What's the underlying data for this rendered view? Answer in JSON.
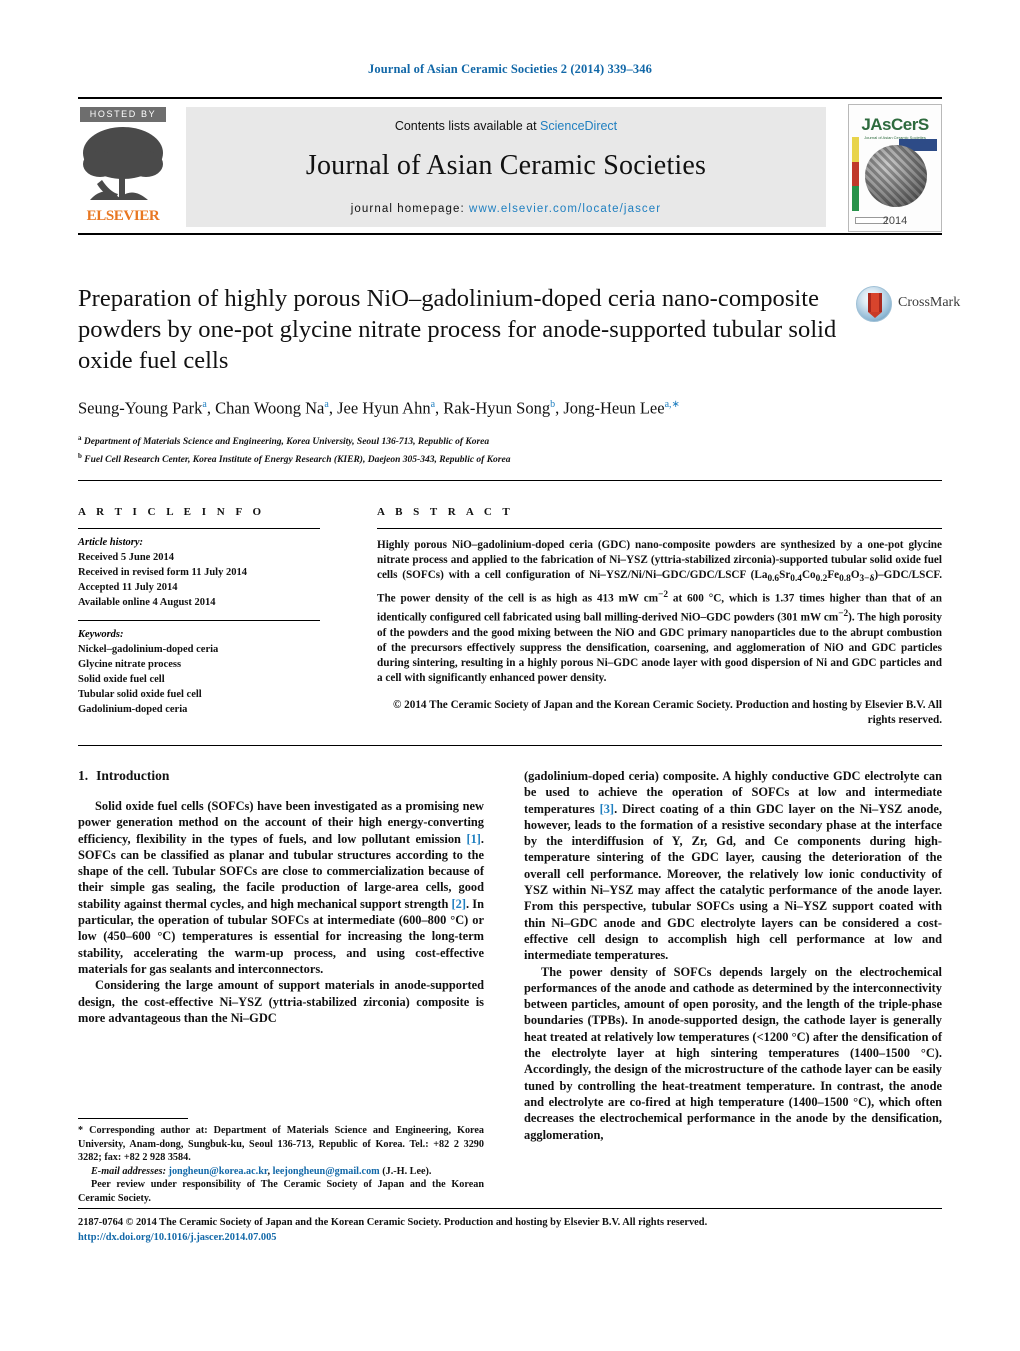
{
  "running_head": "Journal of Asian Ceramic Societies 2 (2014) 339–346",
  "masthead": {
    "hosted_by": "HOSTED BY",
    "publisher": "ELSEVIER",
    "contents_prefix": "Contents lists available at ",
    "contents_link": "ScienceDirect",
    "journal_title": "Journal of Asian Ceramic Societies",
    "homepage_prefix": "journal homepage: ",
    "homepage_url": "www.elsevier.com/locate/jascer",
    "cover": {
      "brand": "JAsCerS",
      "subtitle": "Journal of Asian Ceramic Societies",
      "year": "2014"
    }
  },
  "article": {
    "title": "Preparation of highly porous NiO–gadolinium-doped ceria nano-composite powders by one-pot glycine nitrate process for anode-supported tubular solid oxide fuel cells",
    "authors_html": "Seung-Young Park<sup>a</sup>, Chan Woong Na<sup>a</sup>, Jee Hyun Ahn<sup>a</sup>, Rak-Hyun Song<sup>b</sup>, Jong-Heun Lee<sup>a,∗</sup>",
    "affiliation_a": "Department of Materials Science and Engineering, Korea University, Seoul 136-713, Republic of Korea",
    "affiliation_b": "Fuel Cell Research Center, Korea Institute of Energy Research (KIER), Daejeon 305-343, Republic of Korea",
    "crossmark_label": "CrossMark"
  },
  "article_info": {
    "heading": "A R T I C L E    I N F O",
    "history_label": "Article history:",
    "history": [
      "Received 5 June 2014",
      "Received in revised form 11 July 2014",
      "Accepted 11 July 2014",
      "Available online 4 August 2014"
    ],
    "keywords_label": "Keywords:",
    "keywords": [
      "Nickel–gadolinium-doped ceria",
      "Glycine nitrate process",
      "Solid oxide fuel cell",
      "Tubular solid oxide fuel cell",
      "Gadolinium-doped ceria"
    ]
  },
  "abstract": {
    "heading": "A B S T R A C T",
    "text": "Highly porous NiO–gadolinium-doped ceria (GDC) nano-composite powders are synthesized by a one-pot glycine nitrate process and applied to the fabrication of Ni–YSZ (yttria-stabilized zirconia)-supported tubular solid oxide fuel cells (SOFCs) with a cell configuration of Ni–YSZ/Ni/Ni–GDC/GDC/LSCF (La0.6Sr0.4Co0.2Fe0.8O3−δ)–GDC/LSCF. The power density of the cell is as high as 413 mW cm−2 at 600 °C, which is 1.37 times higher than that of an identically configured cell fabricated using ball milling-derived NiO–GDC powders (301 mW cm−2). The high porosity of the powders and the good mixing between the NiO and GDC primary nanoparticles due to the abrupt combustion of the precursors effectively suppress the densification, coarsening, and agglomeration of NiO and GDC particles during sintering, resulting in a highly porous Ni–GDC anode layer with good dispersion of Ni and GDC particles and a cell with significantly enhanced power density.",
    "copyright": "© 2014 The Ceramic Society of Japan and the Korean Ceramic Society. Production and hosting by Elsevier B.V. All rights reserved."
  },
  "introduction": {
    "number": "1.",
    "heading": "Introduction",
    "paragraph_1": "Solid oxide fuel cells (SOFCs) have been investigated as a promising new power generation method on the account of their high energy-converting efficiency, flexibility in the types of fuels, and low pollutant emission [1]. SOFCs can be classified as planar and tubular structures according to the shape of the cell. Tubular SOFCs are close to commercialization because of their simple gas sealing, the facile production of large-area cells, good stability against thermal cycles, and high mechanical support strength [2]. In particular, the operation of tubular SOFCs at intermediate (600–800 °C) or low (450–600 °C) temperatures is essential for increasing the long-term stability, accelerating the warm-up process, and using cost-effective materials for gas sealants and interconnectors.",
    "paragraph_2": "Considering the large amount of support materials in anode-supported design, the cost-effective Ni–YSZ (yttria-stabilized zirconia) composite is more advantageous than the Ni–GDC (gadolinium-doped ceria) composite. A highly conductive GDC electrolyte can be used to achieve the operation of SOFCs at low and intermediate temperatures [3]. Direct coating of a thin GDC layer on the Ni–YSZ anode, however, leads to the formation of a resistive secondary phase at the interface by the interdiffusion of Y, Zr, Gd, and Ce components during high-temperature sintering of the GDC layer, causing the deterioration of the overall cell performance. Moreover, the relatively low ionic conductivity of YSZ within Ni–YSZ may affect the catalytic performance of the anode layer. From this perspective, tubular SOFCs using a Ni–YSZ support coated with thin Ni–GDC anode and GDC electrolyte layers can be considered a cost-effective cell design to accomplish high cell performance at low and intermediate temperatures.",
    "paragraph_3": "The power density of SOFCs depends largely on the electrochemical performances of the anode and cathode as determined by the interconnectivity between particles, amount of open porosity, and the length of the triple-phase boundaries (TPBs). In anode-supported design, the cathode layer is generally heat treated at relatively low temperatures (<1200 °C) after the densification of the electrolyte layer at high sintering temperatures (1400–1500 °C). Accordingly, the design of the microstructure of the cathode layer can be easily tuned by controlling the heat-treatment temperature. In contrast, the anode and electrolyte are co-fired at high temperature (1400–1500 °C), which often decreases the electrochemical performance in the anode by the densification, agglomeration,",
    "ref_1": "[1]",
    "ref_2": "[2]",
    "ref_3": "[3]"
  },
  "footnotes": {
    "corresponding": "* Corresponding author at: Department of Materials Science and Engineering, Korea University, Anam-dong, Sungbuk-ku, Seoul 136-713, Republic of Korea. Tel.: +82 2 3290 3282; fax: +82 2 928 3584.",
    "email_label": "E-mail addresses:",
    "email_1": "jongheun@korea.ac.kr",
    "email_2": "leejongheun@gmail.com",
    "email_suffix": "(J.-H. Lee).",
    "peer_review": "Peer review under responsibility of The Ceramic Society of Japan and the Korean Ceramic Society."
  },
  "footer": {
    "issn_copyright": "2187-0764 © 2014 The Ceramic Society of Japan and the Korean Ceramic Society. Production and hosting by Elsevier B.V. All rights reserved.",
    "doi": "http://dx.doi.org/10.1016/j.jascer.2014.07.005"
  },
  "colors": {
    "link": "#1f7fc0",
    "header_link": "#1268a8",
    "elsevier_orange": "#e87722",
    "jascers_green": "#2e6b3e"
  }
}
